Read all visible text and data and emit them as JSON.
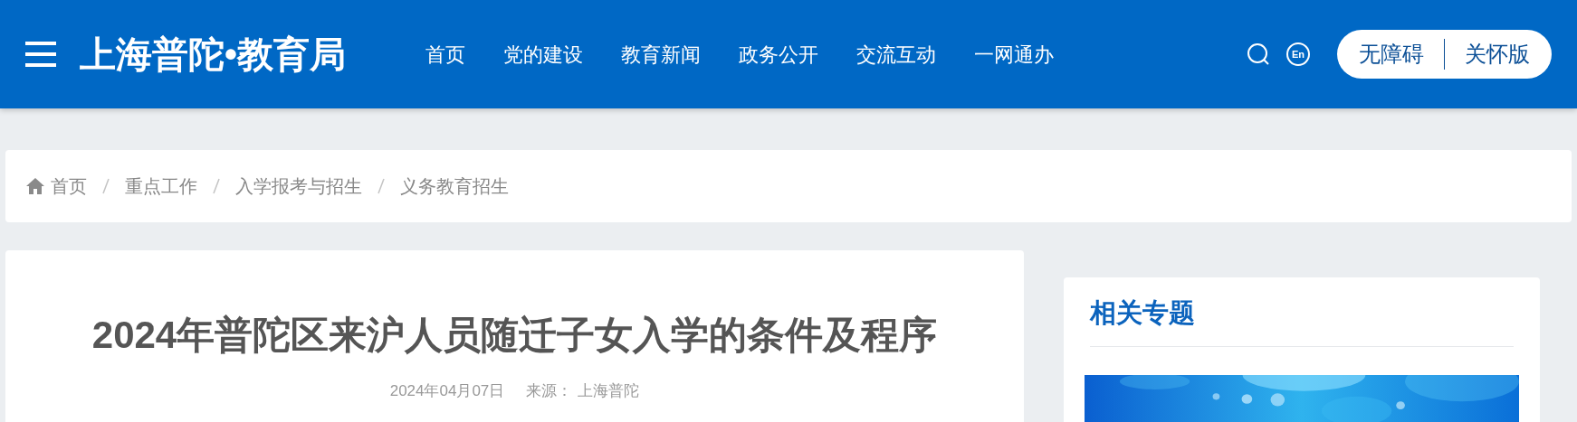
{
  "header": {
    "logo": "上海普陀•教育局",
    "nav": [
      {
        "label": "首页"
      },
      {
        "label": "党的建设"
      },
      {
        "label": "教育新闻"
      },
      {
        "label": "政务公开"
      },
      {
        "label": "交流互动"
      },
      {
        "label": "一网通办"
      }
    ],
    "language": "En",
    "modes": [
      "无障碍",
      "关怀版"
    ]
  },
  "breadcrumb": [
    "首页",
    "重点工作",
    "入学报考与招生",
    "义务教育招生"
  ],
  "article": {
    "title": "2024年普陀区来沪人员随迁子女入学的条件及程序",
    "date": "2024年04月07日",
    "source_label": "来源：",
    "source": "上海普陀"
  },
  "sidebar": {
    "title": "相关专题"
  }
}
